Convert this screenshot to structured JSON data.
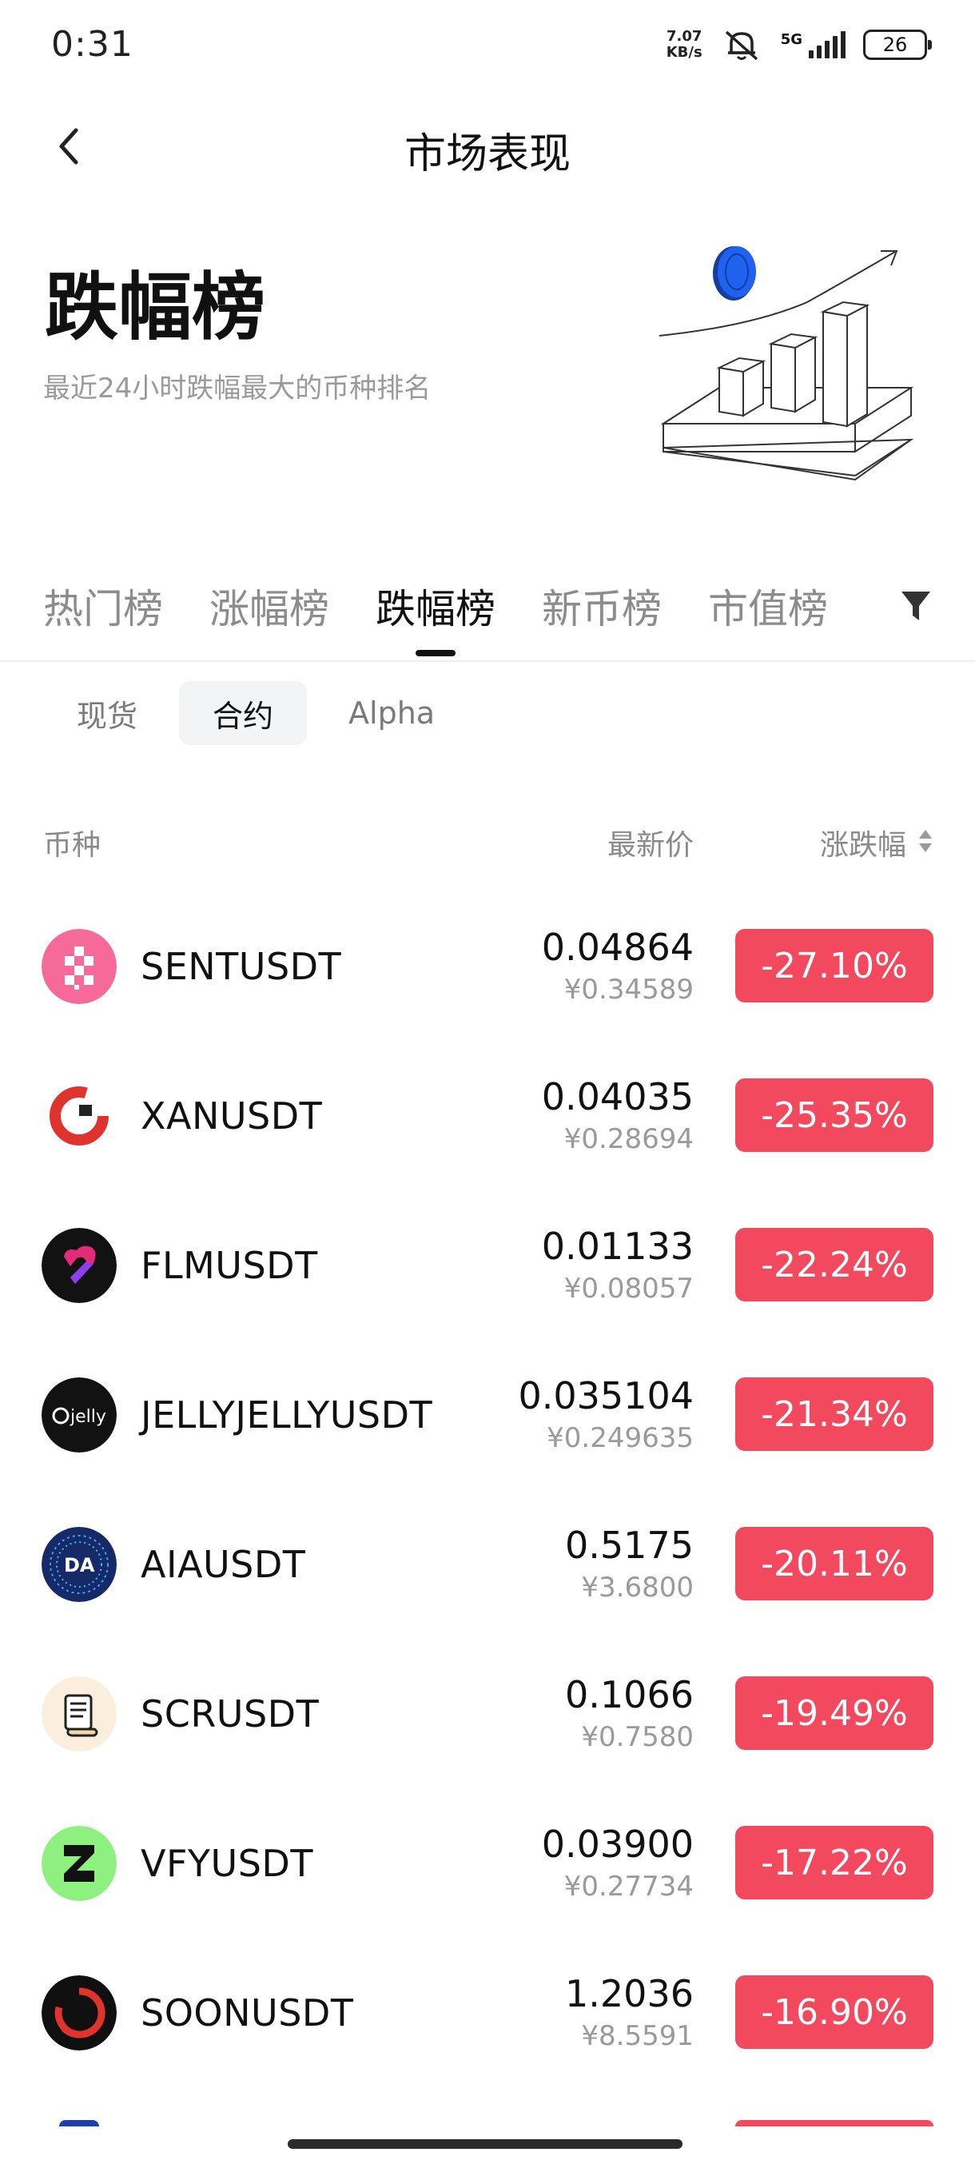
{
  "status_bar": {
    "time": "0:31",
    "net_speed_value": "7.07",
    "net_speed_unit": "KB/s",
    "signal_label": "5G",
    "battery": "26"
  },
  "header": {
    "title": "市场表现",
    "back_icon": "chevron-left-icon"
  },
  "hero": {
    "title": "跌幅榜",
    "subtitle": "最近24小时跌幅最大的币种排名",
    "illustration": "bar-chart-growth-illustration"
  },
  "main_tabs": [
    {
      "label": "热门榜",
      "active": false
    },
    {
      "label": "涨幅榜",
      "active": false
    },
    {
      "label": "跌幅榜",
      "active": true
    },
    {
      "label": "新币榜",
      "active": false
    },
    {
      "label": "市值榜",
      "active": false
    }
  ],
  "filter_icon": "funnel-filter-icon",
  "sub_tabs": [
    {
      "label": "现货",
      "active": false
    },
    {
      "label": "合约",
      "active": true
    },
    {
      "label": "Alpha",
      "active": false
    }
  ],
  "table_header": {
    "coin": "币种",
    "price": "最新价",
    "change": "涨跌幅",
    "sort_icon": "sort-updown-icon"
  },
  "rows": [
    {
      "symbol": "SENTUSDT",
      "price": "0.04864",
      "price_cny": "¥0.34589",
      "change": "-27.10%",
      "logo_color": "#f56a98"
    },
    {
      "symbol": "XANUSDT",
      "price": "0.04035",
      "price_cny": "¥0.28694",
      "change": "-25.35%",
      "logo_color": "#e0332d"
    },
    {
      "symbol": "FLMUSDT",
      "price": "0.01133",
      "price_cny": "¥0.08057",
      "change": "-22.24%",
      "logo_color": "#121212"
    },
    {
      "symbol": "JELLYJELLYUSDT",
      "price": "0.035104",
      "price_cny": "¥0.249635",
      "change": "-21.34%",
      "logo_color": "#121212"
    },
    {
      "symbol": "AIAUSDT",
      "price": "0.5175",
      "price_cny": "¥3.6800",
      "change": "-20.11%",
      "logo_color": "#152a66"
    },
    {
      "symbol": "SCRUSDT",
      "price": "0.1066",
      "price_cny": "¥0.7580",
      "change": "-19.49%",
      "logo_color": "#fbeedc"
    },
    {
      "symbol": "VFYUSDT",
      "price": "0.03900",
      "price_cny": "¥0.27734",
      "change": "-17.22%",
      "logo_color": "#8ef07e"
    },
    {
      "symbol": "SOONUSDT",
      "price": "1.2036",
      "price_cny": "¥8.5591",
      "change": "-16.90%",
      "logo_color": "#101010"
    }
  ],
  "colors": {
    "negative_badge": "#f2495e",
    "accent_blue": "#1f62f0",
    "muted_text": "#9a9a9a"
  }
}
